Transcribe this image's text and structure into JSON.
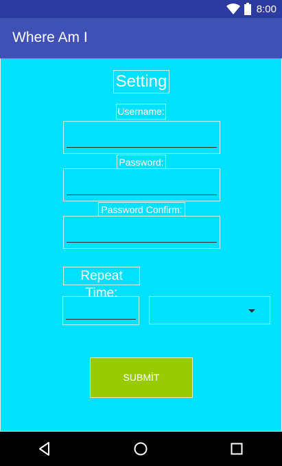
{
  "status_bar": {
    "time": "8:00",
    "icons": [
      "wifi-icon",
      "battery-icon"
    ]
  },
  "app_bar": {
    "title": "Where Am I"
  },
  "form": {
    "heading": "Setting",
    "username_label": "Username:",
    "username_value": "",
    "password_label": "Password:",
    "password_value": "",
    "password_confirm_label": "Password Confirm:",
    "password_confirm_value": "",
    "repeat_time_label": "Repeat Time:",
    "repeat_time_value": "",
    "repeat_unit_selected": "",
    "submit_label": "SUBMİT"
  },
  "nav_bar": {
    "icons": [
      "back-icon",
      "home-icon",
      "recents-icon"
    ]
  },
  "colors": {
    "status_bar": "#2c3ba0",
    "app_bar": "#3f51b5",
    "background": "#00e1ff",
    "submit_button": "#99cc00",
    "nav_bar": "#000000"
  }
}
